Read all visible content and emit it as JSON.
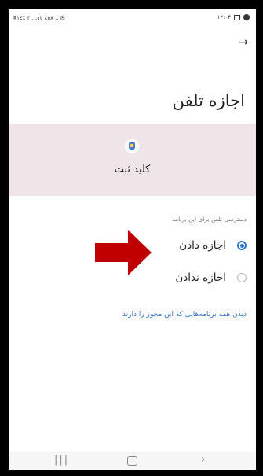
{
  "status_bar": {
    "left_text": "≣٘٤٥٨ ٢ى ..٣ ٪١٤ .. ✉",
    "time": "۱۲:۰۴"
  },
  "header": {
    "back_icon": "arrow-right",
    "title": "اجازه تلفن"
  },
  "app": {
    "name": "کلید ثبت",
    "icon": "app-icon"
  },
  "permission": {
    "section_label": "دسترسی تلفن برای این برنامه",
    "options": [
      {
        "label": "اجازه دادن",
        "selected": true
      },
      {
        "label": "اجازه ندادن",
        "selected": false
      }
    ]
  },
  "see_all_link": "دیدن همه برنامه‌هایی که این مجوز را دارند",
  "annotation": {
    "type": "red-arrow",
    "color": "#c00000"
  },
  "nav_bar": {
    "recent_icon": "recent-apps-icon",
    "home_icon": "home-icon",
    "back_icon": "back-icon"
  },
  "colors": {
    "accent": "#2f74d0",
    "app_card_bg": "#efe4e8",
    "annotation_arrow": "#c00000"
  }
}
